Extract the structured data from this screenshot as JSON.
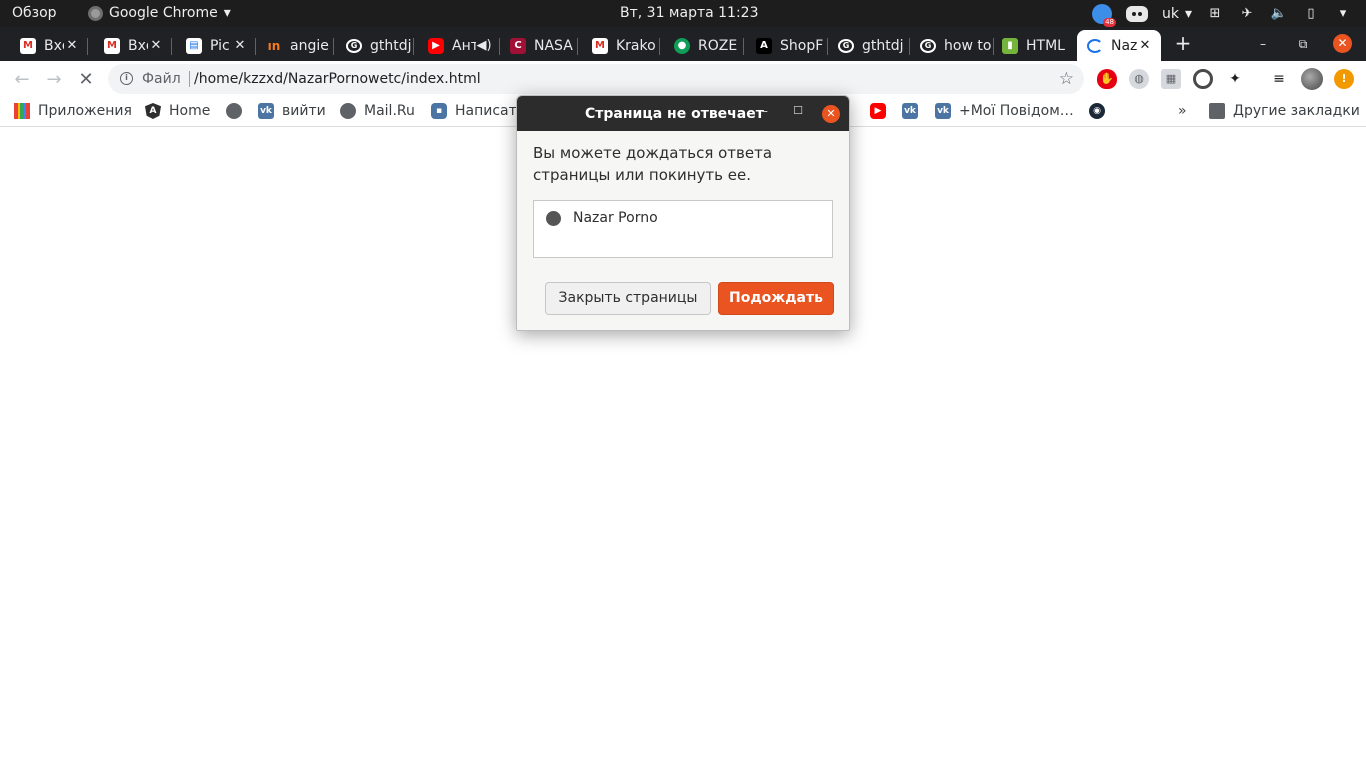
{
  "topbar": {
    "activities": "Обзор",
    "app_name": "Google Chrome",
    "clock": "Вт, 31 марта  11:23",
    "notification_badge": "48",
    "keyboard_layout": "uk"
  },
  "tabs": [
    {
      "title": "Вхо",
      "icon": "gmail-icon"
    },
    {
      "title": "Вхо",
      "icon": "gmail-icon"
    },
    {
      "title": "Pic",
      "icon": "doc-icon"
    },
    {
      "title": "angie",
      "icon": "angie-icon"
    },
    {
      "title": "gthtdj",
      "icon": "google-icon"
    },
    {
      "title": "Ант",
      "icon": "youtube-icon"
    },
    {
      "title": "NASA",
      "icon": "c-icon"
    },
    {
      "title": "Krako",
      "icon": "gmail-icon"
    },
    {
      "title": "ROZE",
      "icon": "green-icon"
    },
    {
      "title": "ShopF",
      "icon": "a-icon"
    },
    {
      "title": "gthtdj",
      "icon": "google-icon"
    },
    {
      "title": "how to",
      "icon": "google-icon"
    },
    {
      "title": "HTML",
      "icon": "html-icon"
    },
    {
      "title": "Naz",
      "icon": "loading-icon"
    }
  ],
  "omnibox": {
    "scheme_label": "Файл",
    "url": "/home/kzzxd/NazarPornowetc/index.html"
  },
  "bookmarks": {
    "apps": "Приложения",
    "home": "Home",
    "logout": "вийти",
    "mailru": "Mail.Ru",
    "write": "Написать",
    "notifications": "+Мої Повідом…",
    "overflow": "»",
    "other": "Другие закладки"
  },
  "dialog": {
    "title": "Страница не отвечает",
    "message": "Вы можете дождаться ответа страницы или покинуть ее.",
    "page_item": "Nazar Porno",
    "close_button": "Закрыть страницы",
    "wait_button": "Подождать"
  },
  "colors": {
    "accent": "#e95420",
    "tabstrip": "#202124",
    "topbar": "#1d1d1d"
  }
}
